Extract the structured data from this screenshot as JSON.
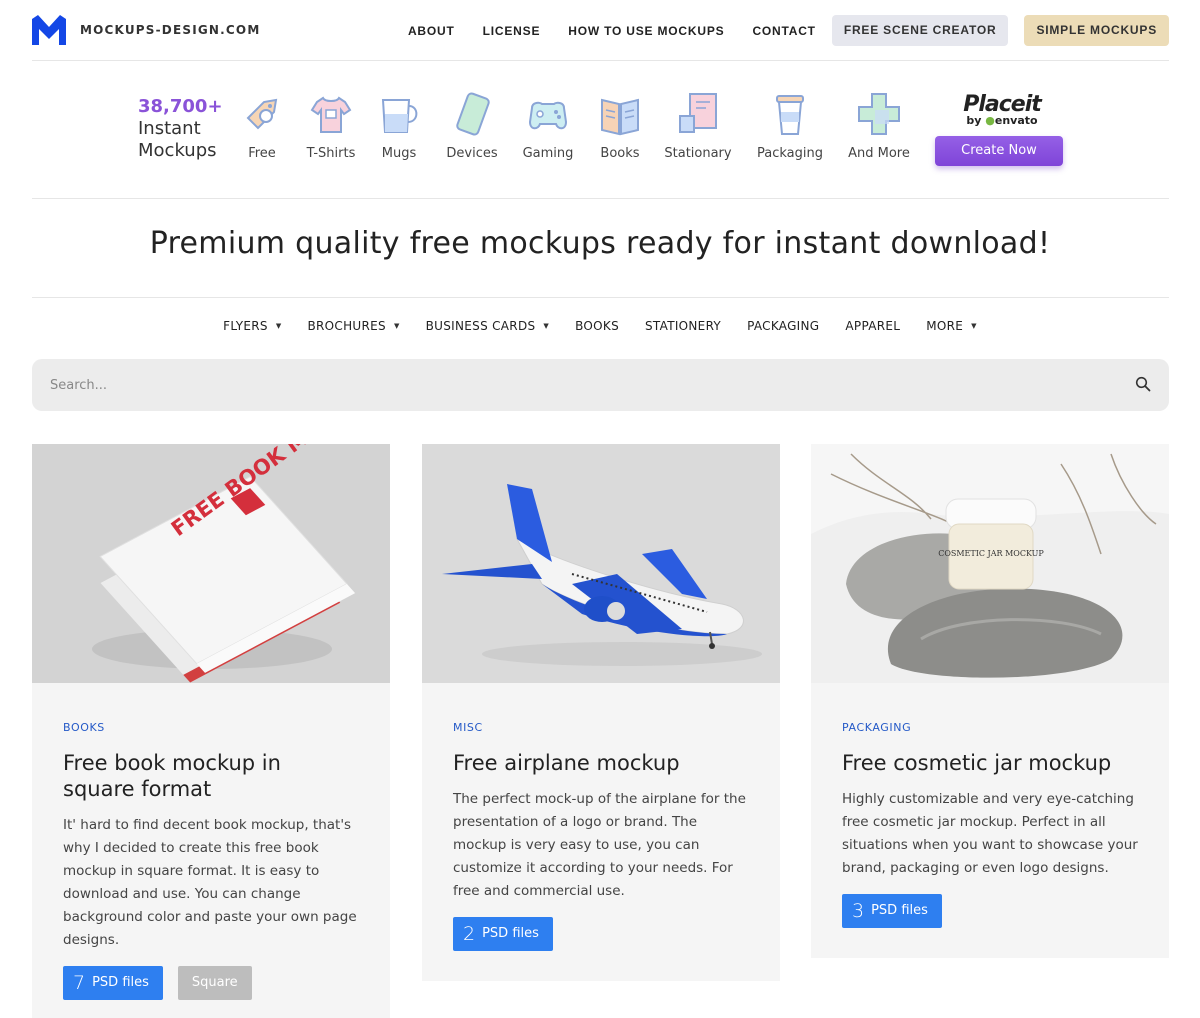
{
  "site": {
    "name": "MOCKUPS-DESIGN.COM"
  },
  "nav": {
    "items": [
      "ABOUT",
      "LICENSE",
      "HOW TO USE MOCKUPS",
      "CONTACT"
    ],
    "scene_creator": "FREE SCENE CREATOR",
    "simple_mockups": "SIMPLE MOCKUPS"
  },
  "banner": {
    "count": "38,700+",
    "line1": "Instant",
    "line2": "Mockups",
    "categories": [
      {
        "label": "Free",
        "icon": "tag-icon"
      },
      {
        "label": "T-Shirts",
        "icon": "tshirt-icon"
      },
      {
        "label": "Mugs",
        "icon": "mug-icon"
      },
      {
        "label": "Devices",
        "icon": "phone-icon"
      },
      {
        "label": "Gaming",
        "icon": "gamepad-icon"
      },
      {
        "label": "Books",
        "icon": "book-icon"
      },
      {
        "label": "Stationary",
        "icon": "stationery-icon"
      },
      {
        "label": "Packaging",
        "icon": "cup-icon"
      },
      {
        "label": "And More",
        "icon": "plus-icon"
      }
    ],
    "placeit": "Placeit",
    "by": "by",
    "envato": "envato",
    "cta": "Create Now"
  },
  "headline": "Premium quality free mockups ready for instant download!",
  "category_menu": [
    {
      "label": "FLYERS",
      "dropdown": true
    },
    {
      "label": "BROCHURES",
      "dropdown": true
    },
    {
      "label": "BUSINESS CARDS",
      "dropdown": true
    },
    {
      "label": "BOOKS",
      "dropdown": false
    },
    {
      "label": "STATIONERY",
      "dropdown": false
    },
    {
      "label": "PACKAGING",
      "dropdown": false
    },
    {
      "label": "APPAREL",
      "dropdown": false
    },
    {
      "label": "MORE",
      "dropdown": true
    }
  ],
  "search": {
    "placeholder": "Search..."
  },
  "cards": [
    {
      "tag": "BOOKS",
      "title": "Free book mockup in square format",
      "description": "It' hard to find decent book mockup, that's why I decided to create this free book mockup in square format. It is easy to download and use. You can change background color and paste your own page designs.",
      "psd_count": "7",
      "psd_label": "PSD files",
      "extra_tag": "Square",
      "image_text": "FREE BOOK MOCKUP"
    },
    {
      "tag": "MISC",
      "title": "Free airplane mockup",
      "description": "The perfect mock-up of the airplane for the presentation of a logo or brand. The mockup is very easy to use, you can customize it according to your needs. For free and commercial use.",
      "psd_count": "2",
      "psd_label": "PSD files"
    },
    {
      "tag": "PACKAGING",
      "title": "Free cosmetic jar mockup",
      "description": "Highly customizable and very eye-catching free cosmetic jar mockup. Perfect in all situations when you want to showcase your brand, packaging or even logo designs.",
      "psd_count": "3",
      "psd_label": "PSD files",
      "image_text": "COSMETIC JAR MOCKUP"
    }
  ],
  "colors": {
    "accent": "#2e7ff0",
    "tag": "#2459c7",
    "placeit_purple": "#8a53d8"
  }
}
